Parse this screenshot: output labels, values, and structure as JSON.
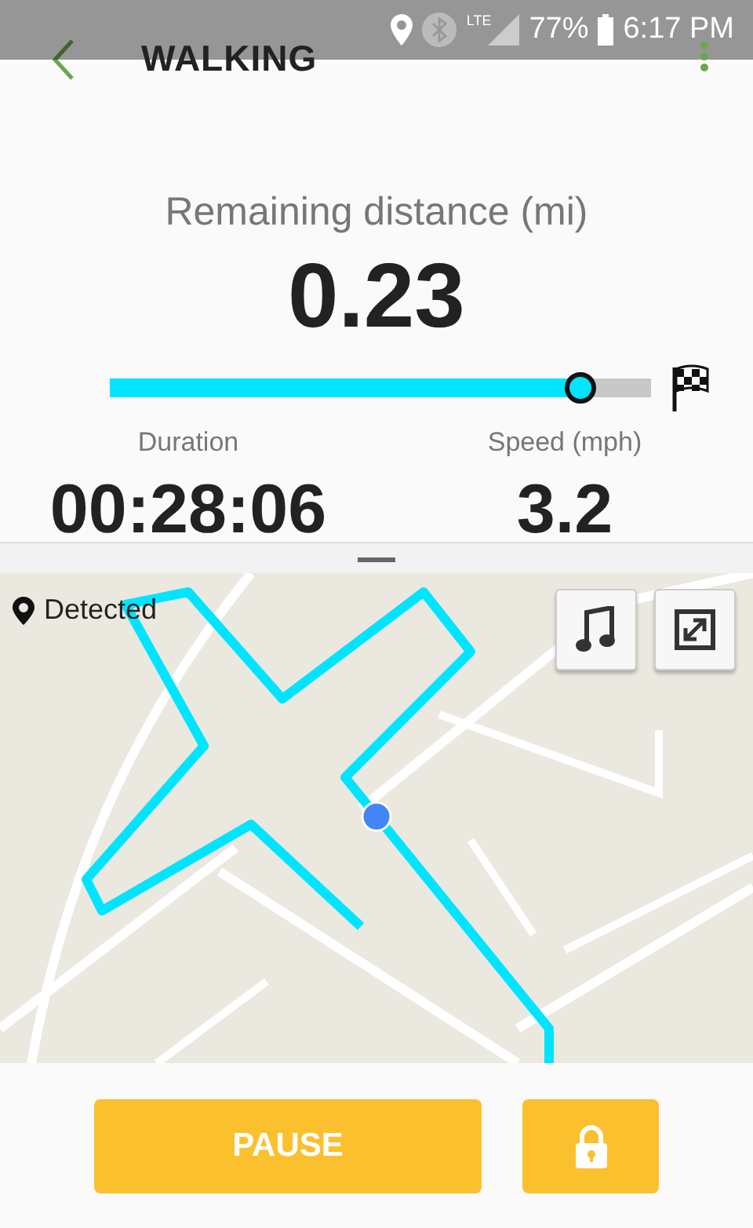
{
  "status_bar": {
    "network": "LTE",
    "battery": "77%",
    "time": "6:17 PM"
  },
  "header": {
    "title": "WALKING"
  },
  "remaining": {
    "label": "Remaining distance (mi)",
    "value": "0.23",
    "level": 0.87
  },
  "stats": [
    {
      "label": "Duration",
      "value": "00:28:06"
    },
    {
      "label": "Speed (mph)",
      "value": "3.2"
    }
  ],
  "map": {
    "gps_status": "Detected"
  },
  "controls": {
    "pause_label": "PAUSE"
  }
}
